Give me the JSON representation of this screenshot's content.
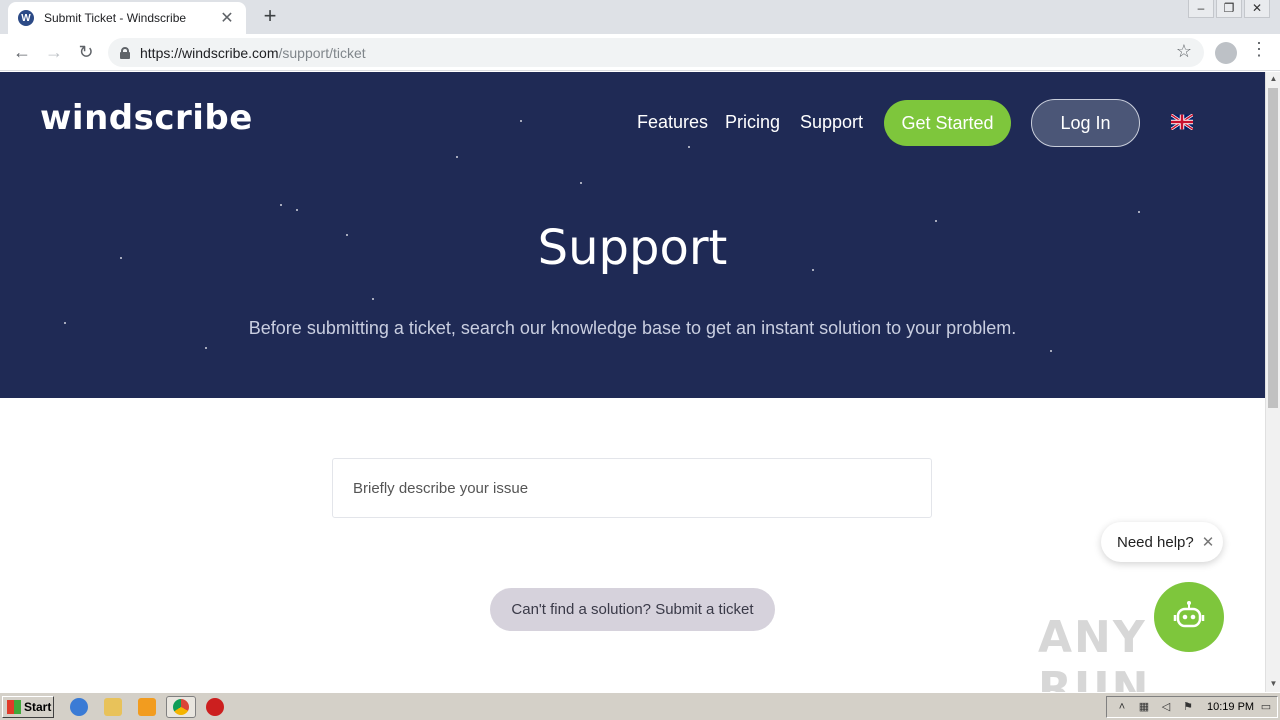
{
  "browser": {
    "tab_title": "Submit Ticket - Windscribe",
    "tab_favicon_letter": "W",
    "new_tab_label": "+",
    "url_host": "https://windscribe.com",
    "url_path": "/support/ticket"
  },
  "header": {
    "logo": "windscribe",
    "nav": [
      "Features",
      "Pricing",
      "Support"
    ],
    "get_started_label": "Get Started",
    "login_label": "Log In",
    "language_icon": "uk-flag-icon"
  },
  "hero": {
    "title": "Support",
    "subtitle": "Before submitting a ticket, search our knowledge base to get an instant solution to your problem."
  },
  "main": {
    "search_placeholder": "Briefly describe your issue",
    "submit_ticket_label": "Can't find a solution? Submit a ticket"
  },
  "chat_widget": {
    "bubble_text": "Need help?",
    "close_glyph": "✕",
    "accent": "#7ec63c"
  },
  "watermark": "ANY RUN",
  "taskbar": {
    "start_label": "Start",
    "clock": "10:19 PM"
  },
  "colors": {
    "hero_bg": "#1f2a55",
    "accent_green": "#7ec63c",
    "submit_bg": "#d6d2dc"
  }
}
